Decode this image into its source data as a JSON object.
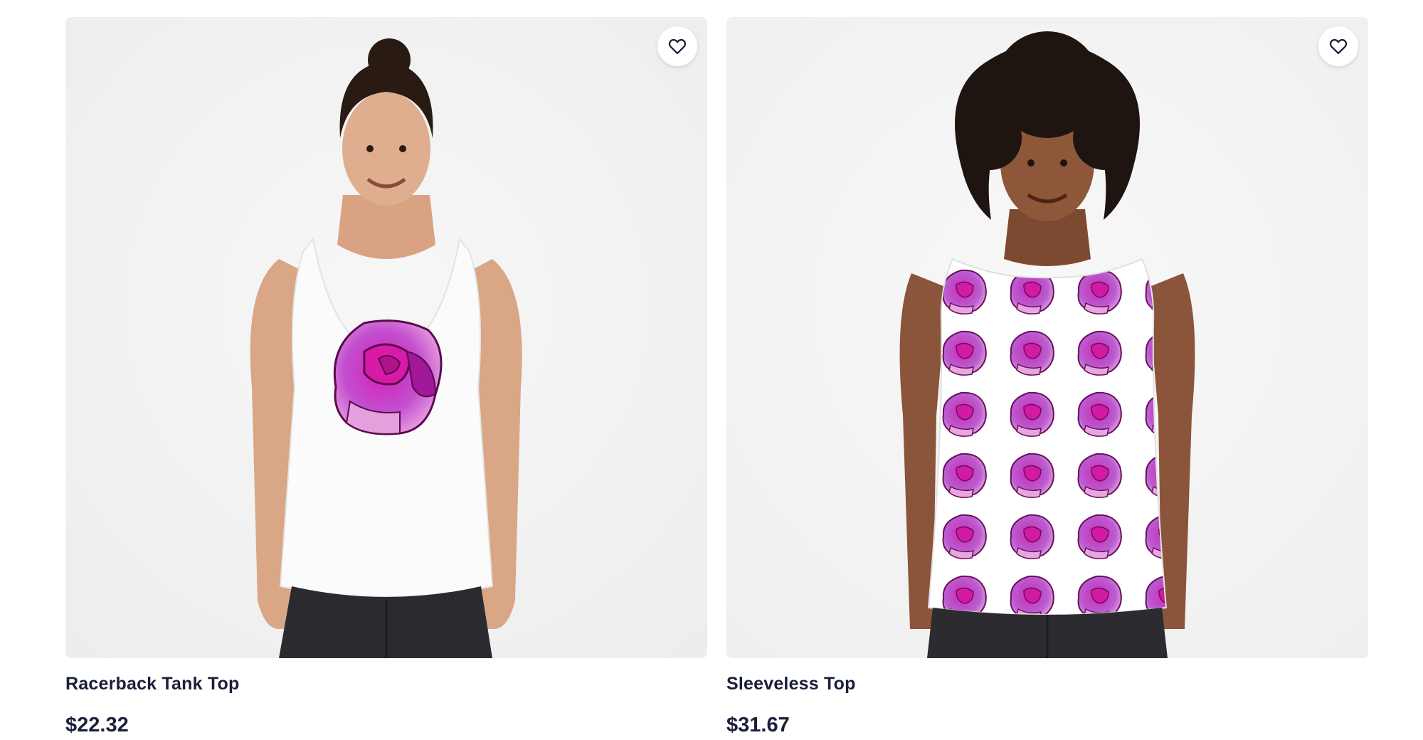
{
  "colors": {
    "text": "#1b1f3b",
    "photo_bg": "#f2f2f2",
    "rose_primary": "#c21fb2",
    "rose_light": "#e7a6e0"
  },
  "products": [
    {
      "title": "Racerback Tank Top",
      "price": "$22.32",
      "image_alt": "Woman wearing white racerback tank top with pink rose print",
      "favorite_icon": "heart-outline-icon"
    },
    {
      "title": "Sleeveless Top",
      "price": "$31.67",
      "image_alt": "Woman wearing white sleeveless top with repeating pink rose pattern",
      "favorite_icon": "heart-outline-icon"
    }
  ]
}
